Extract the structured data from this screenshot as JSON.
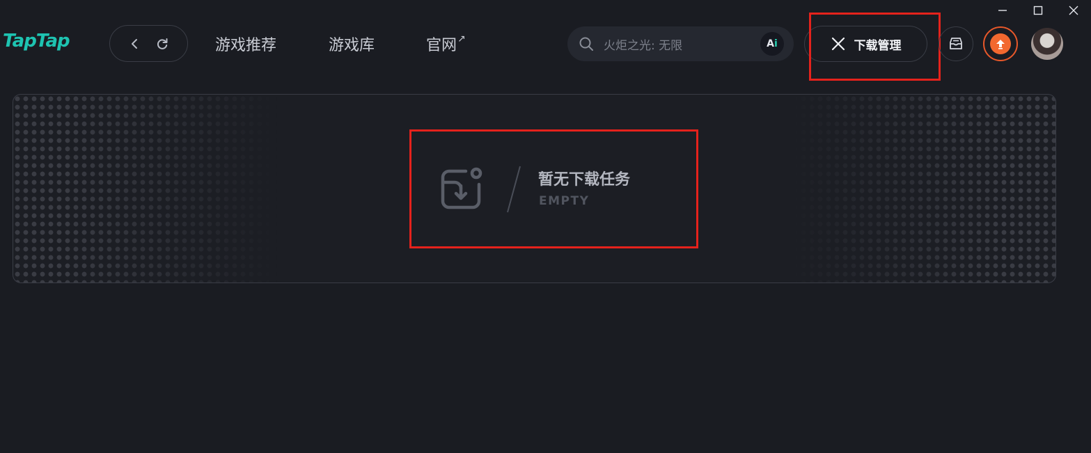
{
  "app": {
    "logo_text": "TapTap"
  },
  "window_controls": {
    "minimize": "minimize-icon",
    "maximize": "maximize-icon",
    "close": "close-icon"
  },
  "nav": {
    "back_icon": "chevron-left-icon",
    "refresh_icon": "refresh-icon"
  },
  "tabs": [
    {
      "label": "游戏推荐"
    },
    {
      "label": "游戏库"
    },
    {
      "label": "官网",
      "suffix": "↗"
    }
  ],
  "search": {
    "placeholder": "火炬之光: 无限",
    "ai_label_a": "A",
    "ai_label_i": "i"
  },
  "download_button": {
    "label": "下载管理",
    "icon": "close-icon"
  },
  "header_icons": {
    "message": "inbox-icon",
    "update": "update-arrow-icon",
    "avatar": "avatar"
  },
  "empty_state": {
    "title": "暂无下载任务",
    "subtitle": "EMPTY",
    "icon": "download-folder-icon"
  },
  "colors": {
    "background": "#1a1c22",
    "brand": "#1ec3b1",
    "highlight": "#e5221c",
    "update": "#f2682f"
  }
}
